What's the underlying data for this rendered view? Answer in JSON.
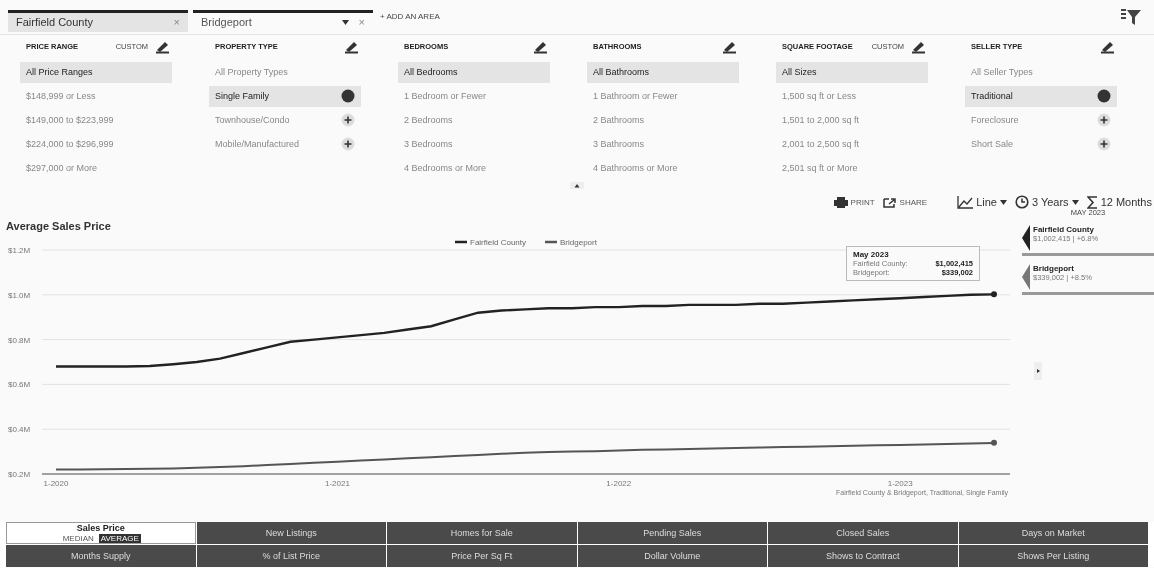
{
  "areas": [
    {
      "label": "Fairfield County",
      "kind": "locked",
      "close": "×"
    },
    {
      "label": "Bridgeport",
      "kind": "dropdown",
      "close": "×"
    }
  ],
  "add_area": "+ ADD AN AREA",
  "filters": [
    {
      "title": "PRICE RANGE",
      "custom": "CUSTOM",
      "items": [
        {
          "label": "All Price Ranges",
          "selected": true,
          "kind": "plain"
        },
        {
          "label": "$148,999 or Less",
          "selected": false,
          "kind": "plain"
        },
        {
          "label": "$149,000 to $223,999",
          "selected": false,
          "kind": "plain"
        },
        {
          "label": "$224,000 to $296,999",
          "selected": false,
          "kind": "plain"
        },
        {
          "label": "$297,000 or More",
          "selected": false,
          "kind": "plain"
        }
      ]
    },
    {
      "title": "PROPERTY TYPE",
      "items": [
        {
          "label": "All Property Types",
          "selected": false,
          "kind": "plain"
        },
        {
          "label": "Single Family",
          "selected": true,
          "kind": "check"
        },
        {
          "label": "Townhouse/Condo",
          "selected": false,
          "kind": "check"
        },
        {
          "label": "Mobile/Manufactured",
          "selected": false,
          "kind": "check"
        }
      ]
    },
    {
      "title": "BEDROOMS",
      "items": [
        {
          "label": "All Bedrooms",
          "selected": true,
          "kind": "plain"
        },
        {
          "label": "1 Bedroom or Fewer",
          "selected": false,
          "kind": "plain"
        },
        {
          "label": "2 Bedrooms",
          "selected": false,
          "kind": "plain"
        },
        {
          "label": "3 Bedrooms",
          "selected": false,
          "kind": "plain"
        },
        {
          "label": "4 Bedrooms or More",
          "selected": false,
          "kind": "plain"
        }
      ]
    },
    {
      "title": "BATHROOMS",
      "items": [
        {
          "label": "All Bathrooms",
          "selected": true,
          "kind": "plain"
        },
        {
          "label": "1 Bathroom or Fewer",
          "selected": false,
          "kind": "plain"
        },
        {
          "label": "2 Bathrooms",
          "selected": false,
          "kind": "plain"
        },
        {
          "label": "3 Bathrooms",
          "selected": false,
          "kind": "plain"
        },
        {
          "label": "4 Bathrooms or More",
          "selected": false,
          "kind": "plain"
        }
      ]
    },
    {
      "title": "SQUARE FOOTAGE",
      "custom": "CUSTOM",
      "items": [
        {
          "label": "All Sizes",
          "selected": true,
          "kind": "plain"
        },
        {
          "label": "1,500 sq ft or Less",
          "selected": false,
          "kind": "plain"
        },
        {
          "label": "1,501 to 2,000 sq ft",
          "selected": false,
          "kind": "plain"
        },
        {
          "label": "2,001 to 2,500 sq ft",
          "selected": false,
          "kind": "plain"
        },
        {
          "label": "2,501 sq ft or More",
          "selected": false,
          "kind": "plain"
        }
      ]
    },
    {
      "title": "SELLER TYPE",
      "items": [
        {
          "label": "All Seller Types",
          "selected": false,
          "kind": "plain"
        },
        {
          "label": "Traditional",
          "selected": true,
          "kind": "check"
        },
        {
          "label": "Foreclosure",
          "selected": false,
          "kind": "check"
        },
        {
          "label": "Short Sale",
          "selected": false,
          "kind": "check"
        }
      ]
    }
  ],
  "toolbar": {
    "print": "PRINT",
    "share": "SHARE",
    "chart_type": "Line",
    "range": "3 Years",
    "rolling": "12 Months"
  },
  "current_month": "MAY 2023",
  "legend_cards": [
    {
      "name": "Fairfield County",
      "value": "$1,002,415 | +6.8%",
      "color": "#222222"
    },
    {
      "name": "Bridgeport",
      "value": "$339,002 | +8.5%",
      "color": "#777777"
    }
  ],
  "chart": {
    "tooltip": {
      "title": "May 2023",
      "rows": [
        {
          "label": "Fairfield County:",
          "value": "$1,002,415"
        },
        {
          "label": "Bridgeport:",
          "value": "$339,002"
        }
      ]
    },
    "footnote": "Fairfield County & Bridgeport, Traditional, Single Family",
    "chart_data": {
      "type": "line",
      "title": "Average Sales Price",
      "categories": [
        "1-2020",
        null,
        null,
        null,
        null,
        null,
        null,
        null,
        null,
        null,
        null,
        null,
        "1-2021",
        null,
        null,
        null,
        null,
        null,
        null,
        null,
        null,
        null,
        null,
        null,
        "1-2022",
        null,
        null,
        null,
        null,
        null,
        null,
        null,
        null,
        null,
        null,
        null,
        "1-2023",
        null,
        null,
        null,
        null
      ],
      "ylim": [
        0.2,
        1.2
      ],
      "grid": true,
      "legend": true,
      "yticks": [
        {
          "value": 1.2,
          "label": "$1.2M"
        },
        {
          "value": 1.0,
          "label": "$1.0M"
        },
        {
          "value": 0.8,
          "label": "$0.8M"
        },
        {
          "value": 0.6,
          "label": "$0.6M"
        },
        {
          "value": 0.4,
          "label": "$0.4M"
        },
        {
          "value": 0.2,
          "label": "$0.2M"
        }
      ],
      "series": [
        {
          "name": "Fairfield County",
          "color": "#222222",
          "values": [
            0.68,
            0.68,
            0.68,
            0.68,
            0.682,
            0.69,
            0.7,
            0.715,
            0.74,
            0.765,
            0.79,
            0.8,
            0.81,
            0.82,
            0.83,
            0.845,
            0.86,
            0.89,
            0.92,
            0.93,
            0.935,
            0.94,
            0.94,
            0.945,
            0.945,
            0.95,
            0.95,
            0.955,
            0.955,
            0.955,
            0.96,
            0.96,
            0.965,
            0.97,
            0.975,
            0.98,
            0.985,
            0.99,
            0.995,
            1.0,
            1.002
          ]
        },
        {
          "name": "Bridgeport",
          "color": "#555555",
          "values": [
            0.22,
            0.22,
            0.221,
            0.222,
            0.223,
            0.225,
            0.228,
            0.231,
            0.235,
            0.24,
            0.245,
            0.25,
            0.255,
            0.26,
            0.265,
            0.27,
            0.275,
            0.28,
            0.285,
            0.29,
            0.295,
            0.298,
            0.3,
            0.302,
            0.305,
            0.308,
            0.31,
            0.312,
            0.314,
            0.316,
            0.318,
            0.32,
            0.322,
            0.324,
            0.326,
            0.328,
            0.33,
            0.332,
            0.334,
            0.336,
            0.339
          ]
        }
      ]
    }
  },
  "metrics": [
    {
      "label": "Sales Price",
      "selected": true,
      "options": [
        {
          "label": "MEDIAN",
          "selected": false
        },
        {
          "label": "AVERAGE",
          "selected": true
        }
      ]
    },
    {
      "label": "New Listings",
      "selected": false
    },
    {
      "label": "Homes for Sale",
      "selected": false
    },
    {
      "label": "Pending Sales",
      "selected": false
    },
    {
      "label": "Closed Sales",
      "selected": false
    },
    {
      "label": "Days on Market",
      "selected": false
    },
    {
      "label": "Months Supply",
      "selected": false
    },
    {
      "label": "% of List Price",
      "selected": false
    },
    {
      "label": "Price Per Sq Ft",
      "selected": false
    },
    {
      "label": "Dollar Volume",
      "selected": false
    },
    {
      "label": "Shows to Contract",
      "selected": false
    },
    {
      "label": "Shows Per Listing",
      "selected": false
    }
  ]
}
